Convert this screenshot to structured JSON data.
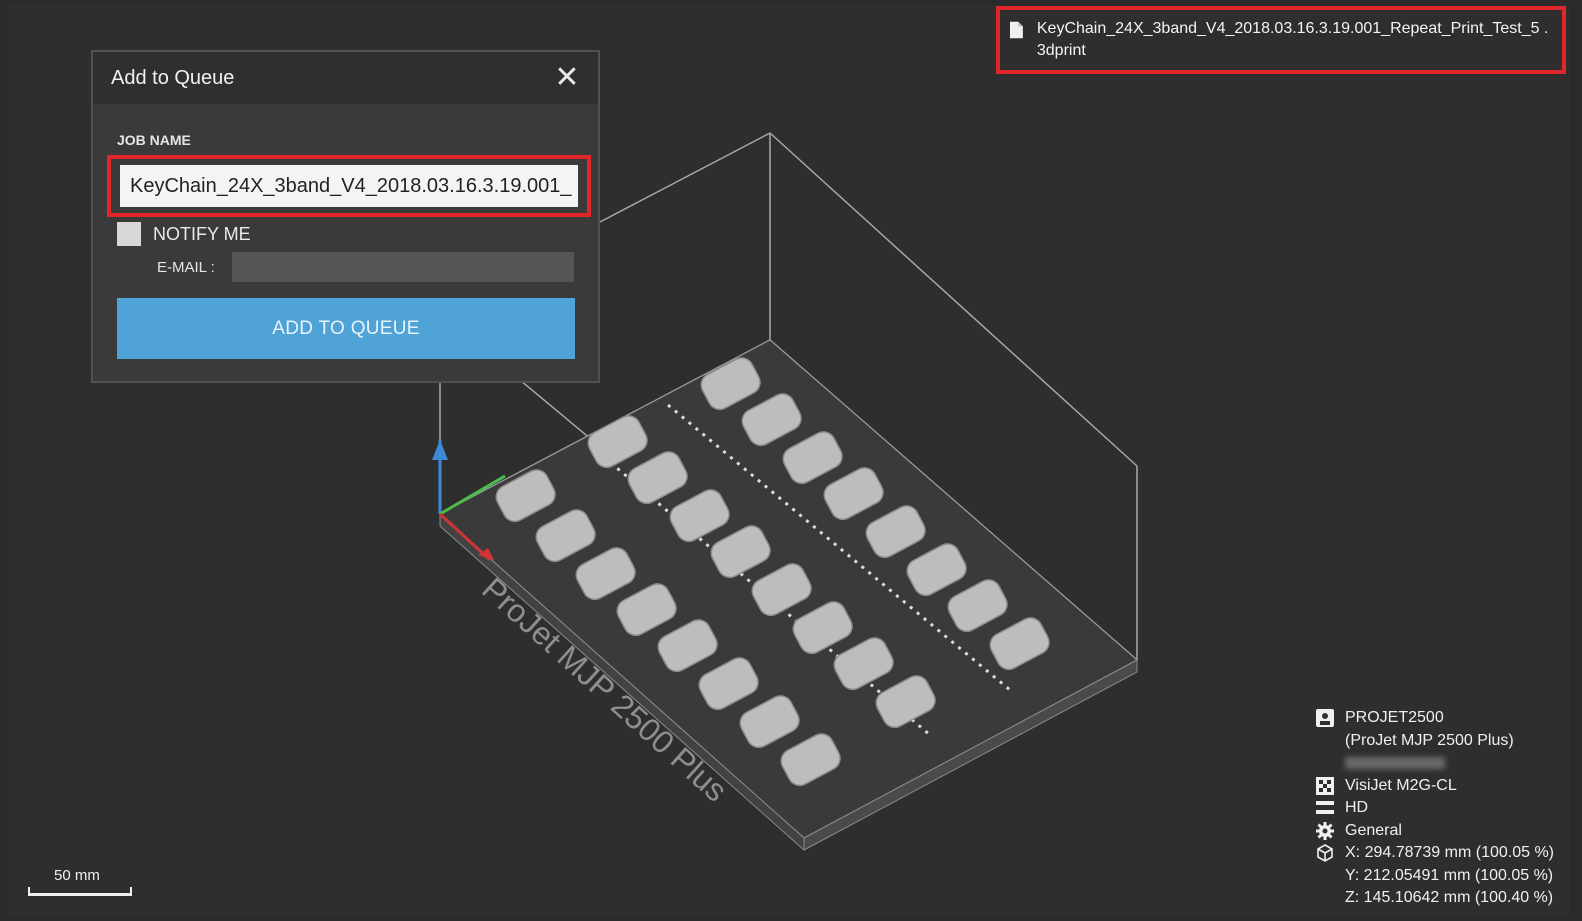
{
  "dialog": {
    "title": "Add to Queue",
    "close_icon": "close-icon",
    "job_name_label": "JOB NAME",
    "job_name_value": "KeyChain_24X_3band_V4_2018.03.16.3.19.001_",
    "notify_label": "NOTIFY ME",
    "notify_checked": false,
    "email_label": "E-MAIL :",
    "email_value": "",
    "submit_label": "ADD TO QUEUE"
  },
  "file": {
    "icon": "file-icon",
    "name": "KeyChain_24X_3band_V4_2018.03.16.3.19.001_Repeat_Print_Test_5 .3dprint"
  },
  "scene": {
    "platform_label": "ProJet MJP 2500 Plus",
    "part_count": 24
  },
  "printer_info": {
    "name": "PROJET2500",
    "model": "(ProJet MJP 2500 Plus)",
    "material": "VisiJet M2G-CL",
    "mode": "HD",
    "profile": "General",
    "x": "X:  294.78739 mm (100.05 %)",
    "y": "Y:  212.05491 mm (100.05 %)",
    "z": "Z:  145.10642 mm (100.40 %)"
  },
  "scale_bar": {
    "label": "50 mm"
  },
  "colors": {
    "highlight": "#e0252b",
    "button": "#4fa3d6",
    "background": "#2e2e2e"
  }
}
